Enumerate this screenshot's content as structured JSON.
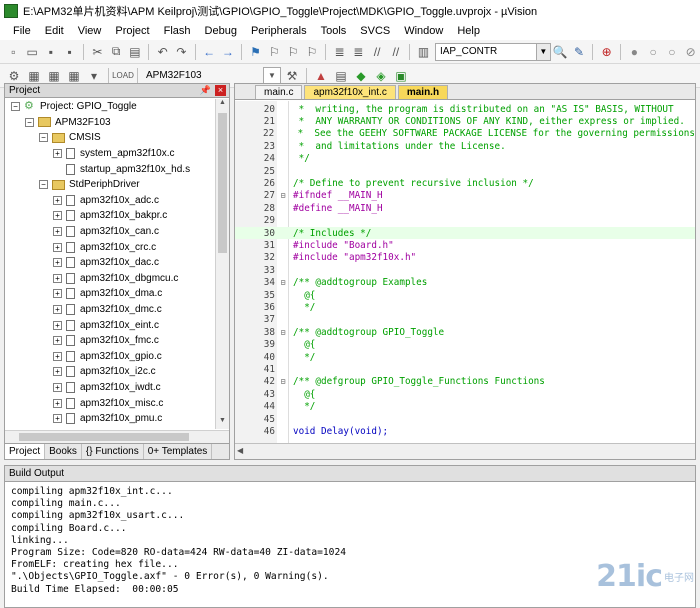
{
  "window": {
    "title": "E:\\APM32单片机资料\\APM Keilproj\\测试\\GPIO\\GPIO_Toggle\\Project\\MDK\\GPIO_Toggle.uvprojx - µVision"
  },
  "menu": [
    "File",
    "Edit",
    "View",
    "Project",
    "Flash",
    "Debug",
    "Peripherals",
    "Tools",
    "SVCS",
    "Window",
    "Help"
  ],
  "toolbar": {
    "search_combo": "IAP_CONTR",
    "target_combo": "APM32F103"
  },
  "project_pane": {
    "title": "Project",
    "tree": [
      {
        "label": "Project: GPIO_Toggle",
        "level": 0,
        "kind": "project",
        "exp": "−"
      },
      {
        "label": "APM32F103",
        "level": 1,
        "kind": "folder",
        "exp": "−"
      },
      {
        "label": "CMSIS",
        "level": 2,
        "kind": "folder",
        "exp": "−"
      },
      {
        "label": "system_apm32f10x.c",
        "level": 3,
        "kind": "file",
        "exp": "+"
      },
      {
        "label": "startup_apm32f10x_hd.s",
        "level": 3,
        "kind": "file",
        "exp": ""
      },
      {
        "label": "StdPeriphDriver",
        "level": 2,
        "kind": "folder",
        "exp": "−"
      },
      {
        "label": "apm32f10x_adc.c",
        "level": 3,
        "kind": "file",
        "exp": "+"
      },
      {
        "label": "apm32f10x_bakpr.c",
        "level": 3,
        "kind": "file",
        "exp": "+"
      },
      {
        "label": "apm32f10x_can.c",
        "level": 3,
        "kind": "file",
        "exp": "+"
      },
      {
        "label": "apm32f10x_crc.c",
        "level": 3,
        "kind": "file",
        "exp": "+"
      },
      {
        "label": "apm32f10x_dac.c",
        "level": 3,
        "kind": "file",
        "exp": "+"
      },
      {
        "label": "apm32f10x_dbgmcu.c",
        "level": 3,
        "kind": "file",
        "exp": "+"
      },
      {
        "label": "apm32f10x_dma.c",
        "level": 3,
        "kind": "file",
        "exp": "+"
      },
      {
        "label": "apm32f10x_dmc.c",
        "level": 3,
        "kind": "file",
        "exp": "+"
      },
      {
        "label": "apm32f10x_eint.c",
        "level": 3,
        "kind": "file",
        "exp": "+"
      },
      {
        "label": "apm32f10x_fmc.c",
        "level": 3,
        "kind": "file",
        "exp": "+"
      },
      {
        "label": "apm32f10x_gpio.c",
        "level": 3,
        "kind": "file",
        "exp": "+"
      },
      {
        "label": "apm32f10x_i2c.c",
        "level": 3,
        "kind": "file",
        "exp": "+"
      },
      {
        "label": "apm32f10x_iwdt.c",
        "level": 3,
        "kind": "file",
        "exp": "+"
      },
      {
        "label": "apm32f10x_misc.c",
        "level": 3,
        "kind": "file",
        "exp": "+"
      },
      {
        "label": "apm32f10x_pmu.c",
        "level": 3,
        "kind": "file",
        "exp": "+"
      }
    ],
    "tabs": [
      "Project",
      "Books",
      "{} Functions",
      "0+ Templates"
    ]
  },
  "editor": {
    "tabs": [
      {
        "label": "main.c",
        "style": ""
      },
      {
        "label": "apm32f10x_int.c",
        "style": "yellow"
      },
      {
        "label": "main.h",
        "style": "active"
      }
    ],
    "lines": [
      {
        "n": "20",
        "fold": "",
        "text": " *  writing, the program is distributed on an \"AS IS\" BASIS, WITHOUT",
        "cls": "c-comment"
      },
      {
        "n": "21",
        "fold": "",
        "text": " *  ANY WARRANTY OR CONDITIONS OF ANY KIND, either express or implied.",
        "cls": "c-comment"
      },
      {
        "n": "22",
        "fold": "",
        "text": " *  See the GEEHY SOFTWARE PACKAGE LICENSE for the governing permissions",
        "cls": "c-comment"
      },
      {
        "n": "23",
        "fold": "",
        "text": " *  and limitations under the License.",
        "cls": "c-comment"
      },
      {
        "n": "24",
        "fold": "",
        "text": " */",
        "cls": "c-comment"
      },
      {
        "n": "25",
        "fold": "",
        "text": "",
        "cls": ""
      },
      {
        "n": "26",
        "fold": "",
        "text": "/* Define to prevent recursive inclusion */",
        "cls": "c-comment"
      },
      {
        "n": "27",
        "fold": "⊟",
        "text": "#ifndef __MAIN_H",
        "cls": "c-pre"
      },
      {
        "n": "28",
        "fold": "",
        "text": "#define __MAIN_H",
        "cls": "c-pre"
      },
      {
        "n": "29",
        "fold": "",
        "text": "",
        "cls": ""
      },
      {
        "n": "30",
        "fold": "",
        "text": "/* Includes */",
        "cls": "c-comment",
        "hl": true
      },
      {
        "n": "31",
        "fold": "",
        "text": "#include \"Board.h\"",
        "cls": "c-pre"
      },
      {
        "n": "32",
        "fold": "",
        "text": "#include \"apm32f10x.h\"",
        "cls": "c-pre"
      },
      {
        "n": "33",
        "fold": "",
        "text": "",
        "cls": ""
      },
      {
        "n": "34",
        "fold": "⊟",
        "text": "/** @addtogroup Examples",
        "cls": "c-comment"
      },
      {
        "n": "35",
        "fold": "",
        "text": "  @{",
        "cls": "c-comment"
      },
      {
        "n": "36",
        "fold": "",
        "text": "  */",
        "cls": "c-comment"
      },
      {
        "n": "37",
        "fold": "",
        "text": "",
        "cls": ""
      },
      {
        "n": "38",
        "fold": "⊟",
        "text": "/** @addtogroup GPIO_Toggle",
        "cls": "c-comment"
      },
      {
        "n": "39",
        "fold": "",
        "text": "  @{",
        "cls": "c-comment"
      },
      {
        "n": "40",
        "fold": "",
        "text": "  */",
        "cls": "c-comment"
      },
      {
        "n": "41",
        "fold": "",
        "text": "",
        "cls": ""
      },
      {
        "n": "42",
        "fold": "⊟",
        "text": "/** @defgroup GPIO_Toggle_Functions Functions",
        "cls": "c-comment"
      },
      {
        "n": "43",
        "fold": "",
        "text": "  @{",
        "cls": "c-comment"
      },
      {
        "n": "44",
        "fold": "",
        "text": "  */",
        "cls": "c-comment"
      },
      {
        "n": "45",
        "fold": "",
        "text": "",
        "cls": ""
      },
      {
        "n": "46",
        "fold": "",
        "text": "void Delay(void);",
        "cls": "c-kw"
      }
    ]
  },
  "build_output": {
    "title": "Build Output",
    "lines": [
      "compiling apm32f10x_int.c...",
      "compiling main.c...",
      "compiling apm32f10x_usart.c...",
      "compiling Board.c...",
      "linking...",
      "Program Size: Code=820 RO-data=424 RW-data=40 ZI-data=1024",
      "FromELF: creating hex file...",
      "\".\\Objects\\GPIO_Toggle.axf\" - 0 Error(s), 0 Warning(s).",
      "Build Time Elapsed:  00:00:05"
    ]
  },
  "watermark": {
    "text": "21ic",
    "sub": "电子网"
  }
}
